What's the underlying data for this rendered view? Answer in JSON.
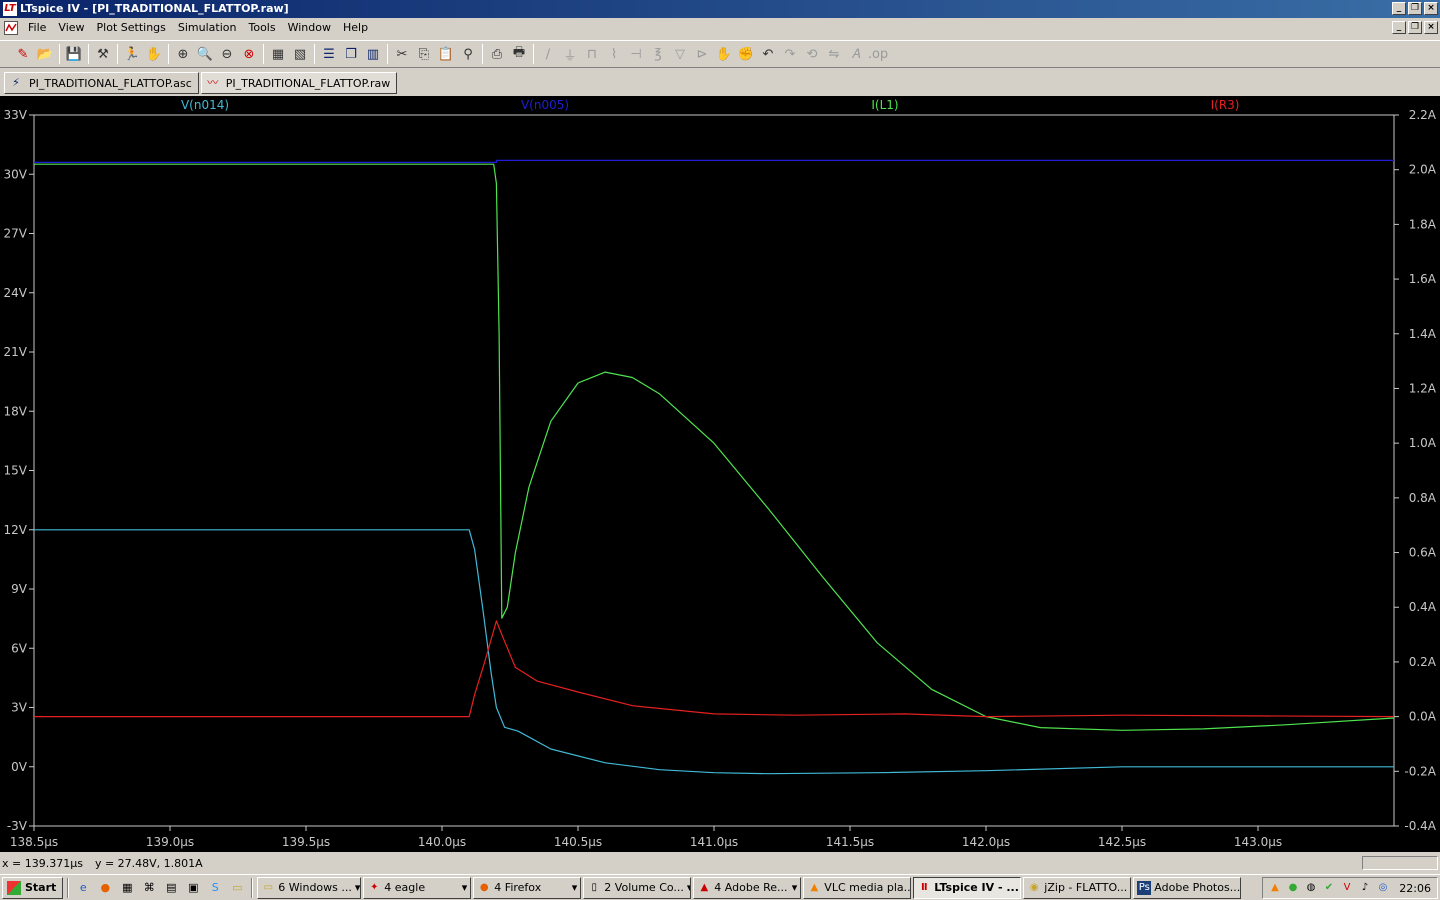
{
  "window": {
    "title": "LTspice IV - [PI_TRADITIONAL_FLATTOP.raw]"
  },
  "menu": [
    "File",
    "View",
    "Plot Settings",
    "Simulation",
    "Tools",
    "Window",
    "Help"
  ],
  "tabs": [
    {
      "label": "PI_TRADITIONAL_FLATTOP.asc"
    },
    {
      "label": "PI_TRADITIONAL_FLATTOP.raw"
    }
  ],
  "status": {
    "cursor_x": "x = 139.371µs",
    "cursor_y": "y = 27.48V, 1.801A"
  },
  "taskbar": {
    "start_label": "Start",
    "tasks": [
      "6 Windows ...",
      "4 eagle",
      "4 Firefox",
      "2 Volume Co...",
      "4 Adobe Re...",
      "VLC media pla...",
      "LTspice IV - ...",
      "jZip - FLATTO...",
      "Adobe Photos..."
    ],
    "clock": "22:06"
  },
  "chart_data": {
    "type": "line",
    "x_ticks": [
      "138.5µs",
      "139.0µs",
      "139.5µs",
      "140.0µs",
      "140.5µs",
      "141.0µs",
      "141.5µs",
      "142.0µs",
      "142.5µs",
      "143.0µs"
    ],
    "x_tick_values": [
      138.5,
      139.0,
      139.5,
      140.0,
      140.5,
      141.0,
      141.5,
      142.0,
      142.5,
      143.0
    ],
    "xlim": [
      138.5,
      143.5
    ],
    "left_ticks": [
      "33V",
      "30V",
      "27V",
      "24V",
      "21V",
      "18V",
      "15V",
      "12V",
      "9V",
      "6V",
      "3V",
      "0V",
      "-3V"
    ],
    "left_tick_values": [
      33,
      30,
      27,
      24,
      21,
      18,
      15,
      12,
      9,
      6,
      3,
      0,
      -3
    ],
    "left_ylim": [
      -3,
      33
    ],
    "right_ticks": [
      "2.2A",
      "2.0A",
      "1.8A",
      "1.6A",
      "1.4A",
      "1.2A",
      "1.0A",
      "0.8A",
      "0.6A",
      "0.4A",
      "0.2A",
      "0.0A",
      "-0.2A",
      "-0.4A"
    ],
    "right_tick_values": [
      2.2,
      2.0,
      1.8,
      1.6,
      1.4,
      1.2,
      1.0,
      0.8,
      0.6,
      0.4,
      0.2,
      0.0,
      -0.2,
      -0.4
    ],
    "right_ylim": [
      -0.4,
      2.2
    ],
    "grid": false,
    "background": "#000000",
    "series": [
      {
        "name": "V(n014)",
        "axis": "left",
        "color": "#41b9d6",
        "points": [
          [
            138.5,
            12.0
          ],
          [
            140.1,
            12.0
          ],
          [
            140.12,
            11.0
          ],
          [
            140.15,
            8.0
          ],
          [
            140.18,
            4.8
          ],
          [
            140.2,
            3.0
          ],
          [
            140.23,
            2.0
          ],
          [
            140.28,
            1.8
          ],
          [
            140.4,
            0.9
          ],
          [
            140.6,
            0.2
          ],
          [
            140.8,
            -0.15
          ],
          [
            141.0,
            -0.3
          ],
          [
            141.2,
            -0.35
          ],
          [
            141.6,
            -0.3
          ],
          [
            142.0,
            -0.2
          ],
          [
            142.5,
            0.0
          ],
          [
            143.5,
            0.0
          ]
        ]
      },
      {
        "name": "V(n005)",
        "axis": "left",
        "color": "#1e1ed6",
        "points": [
          [
            138.5,
            30.6
          ],
          [
            140.2,
            30.6
          ],
          [
            140.2,
            30.7
          ],
          [
            143.5,
            30.7
          ]
        ]
      },
      {
        "name": "I(L1)",
        "axis": "right",
        "color": "#4fe44f",
        "points": [
          [
            138.5,
            2.02
          ],
          [
            140.19,
            2.02
          ],
          [
            140.2,
            1.95
          ],
          [
            140.21,
            1.4
          ],
          [
            140.22,
            0.36
          ],
          [
            140.24,
            0.4
          ],
          [
            140.27,
            0.6
          ],
          [
            140.32,
            0.84
          ],
          [
            140.4,
            1.08
          ],
          [
            140.5,
            1.22
          ],
          [
            140.6,
            1.26
          ],
          [
            140.7,
            1.24
          ],
          [
            140.8,
            1.18
          ],
          [
            141.0,
            1.0
          ],
          [
            141.2,
            0.76
          ],
          [
            141.4,
            0.51
          ],
          [
            141.6,
            0.27
          ],
          [
            141.8,
            0.1
          ],
          [
            142.0,
            0.0
          ],
          [
            142.2,
            -0.04
          ],
          [
            142.5,
            -0.05
          ],
          [
            142.8,
            -0.045
          ],
          [
            143.1,
            -0.03
          ],
          [
            143.5,
            -0.005
          ]
        ]
      },
      {
        "name": "I(R3)",
        "axis": "right",
        "color": "#e52020",
        "points": [
          [
            138.5,
            0.0
          ],
          [
            140.1,
            0.0
          ],
          [
            140.12,
            0.08
          ],
          [
            140.16,
            0.21
          ],
          [
            140.2,
            0.35
          ],
          [
            140.22,
            0.3
          ],
          [
            140.27,
            0.18
          ],
          [
            140.35,
            0.13
          ],
          [
            140.5,
            0.09
          ],
          [
            140.7,
            0.04
          ],
          [
            141.0,
            0.01
          ],
          [
            141.3,
            0.005
          ],
          [
            141.7,
            0.01
          ],
          [
            142.0,
            0.0
          ],
          [
            142.5,
            0.005
          ],
          [
            143.5,
            0.0
          ]
        ]
      }
    ]
  }
}
